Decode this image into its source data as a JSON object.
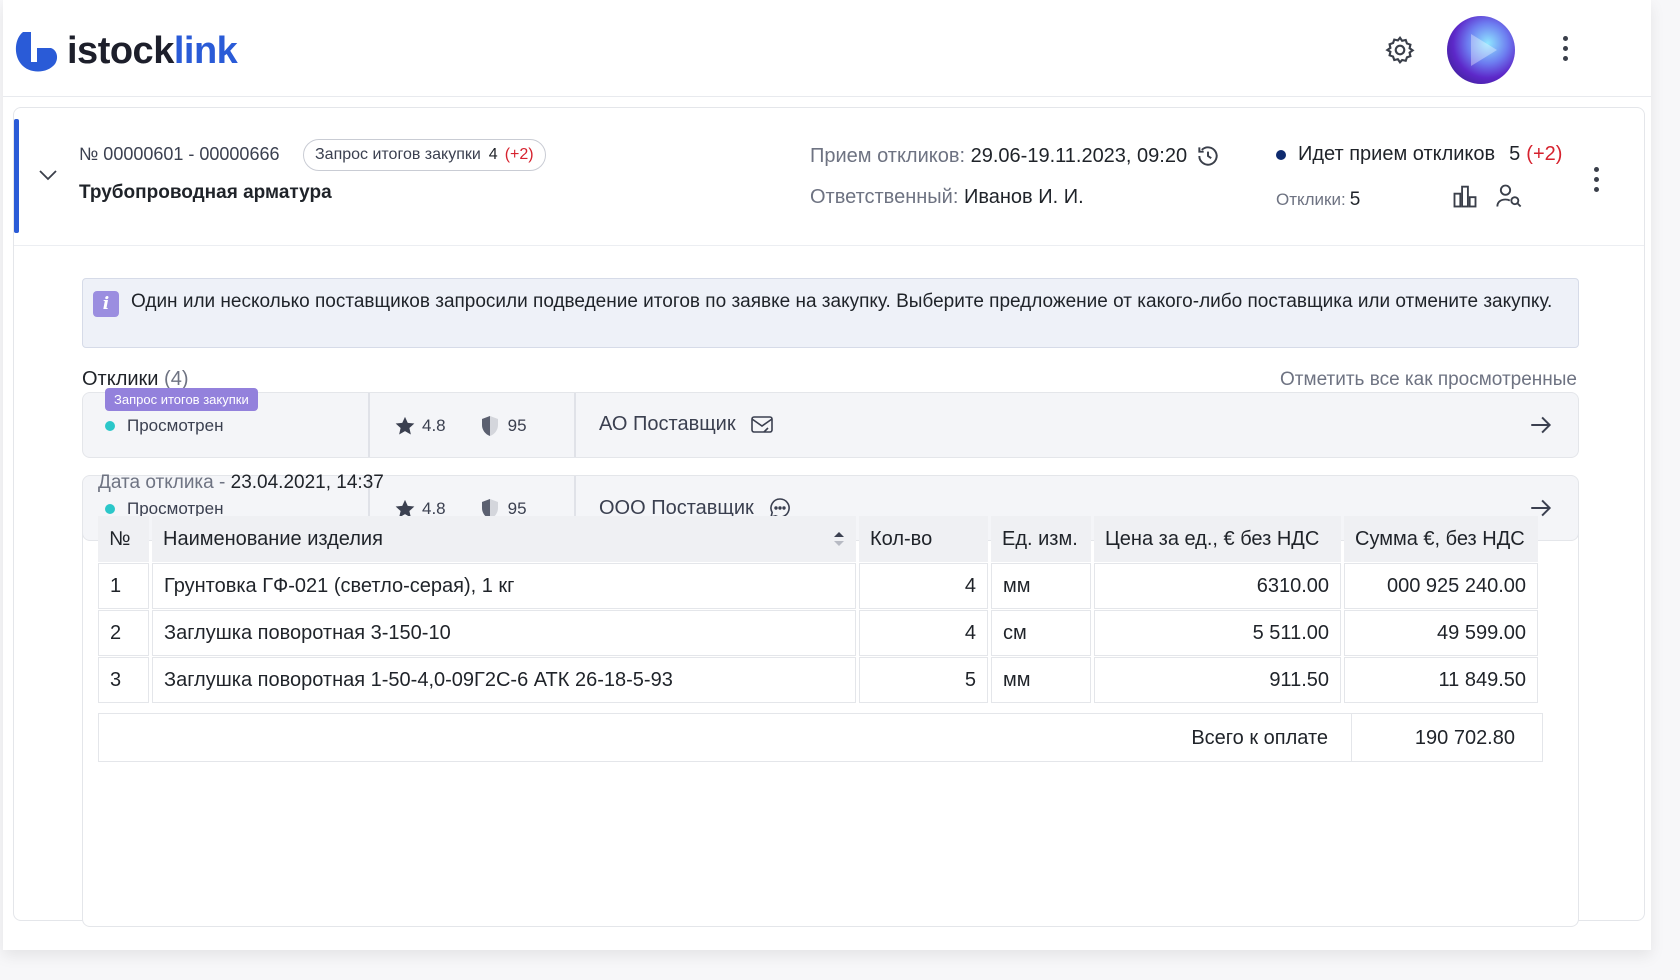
{
  "brand": {
    "name_part1": "istock",
    "name_part2": "link",
    "color": "#2a5bd7"
  },
  "header": {
    "settings_icon": "gear-icon",
    "menu_icon": "more-vertical-icon"
  },
  "request": {
    "number": "№ 00000601 - 00000666",
    "badge_label": "Запрос итогов закупки",
    "badge_count": "4",
    "badge_delta": "(+2)",
    "title": "Трубопроводная арматура",
    "accept_label": "Прием откликов:",
    "accept_value": "29.06-19.11.2023, 09:20",
    "responsible_label": "Ответственный:",
    "responsible_value": "Иванов И. И.",
    "status_label": "Идет прием откликов",
    "status_count": "5",
    "status_delta": "(+2)",
    "responses_label": "Отклики:",
    "responses_value": "5"
  },
  "banner": {
    "icon": "i",
    "text": "Один или несколько поставщиков запросили подведение итогов по заявке на закупку. Выберите предложение от какого-либо поставщика или отмените закупку."
  },
  "responses": {
    "title": "Отклики",
    "count": "(4)",
    "mark_all": "Отметить все как просмотренные",
    "rows": [
      {
        "tag": "Запрос итогов закупки",
        "status": "Просмотрен",
        "rating": "4.8",
        "score": "95",
        "supplier": "АО Поставщик",
        "supplier_icon": "mail-icon"
      },
      {
        "status": "Просмотрен",
        "rating": "4.8",
        "score": "95",
        "supplier": "ООО Поставщик",
        "supplier_icon": "chat-icon"
      }
    ]
  },
  "detail": {
    "date_label": "Дата отклика -",
    "date_value": "23.04.2021, 14:37",
    "columns": [
      "№",
      "Наименование изделия",
      "Кол-во",
      "Ед. изм.",
      "Цена за ед., € без НДС",
      "Сумма €, без НДС"
    ],
    "rows": [
      [
        "1",
        "Грунтовка ГФ-021 (светло-серая), 1 кг",
        "4",
        "мм",
        "6310.00",
        "000 925 240.00"
      ],
      [
        "2",
        "Заглушка поворотная 3-150-10",
        "4",
        "см",
        "5 511.00",
        "49 599.00"
      ],
      [
        "3",
        "Заглушка поворотная 1-50-4,0-09Г2С-6 АТК 26-18-5-93",
        "5",
        "мм",
        "911.50",
        "11 849.50"
      ]
    ],
    "total_label": "Всего к оплате",
    "total_value": "190 702.80"
  }
}
